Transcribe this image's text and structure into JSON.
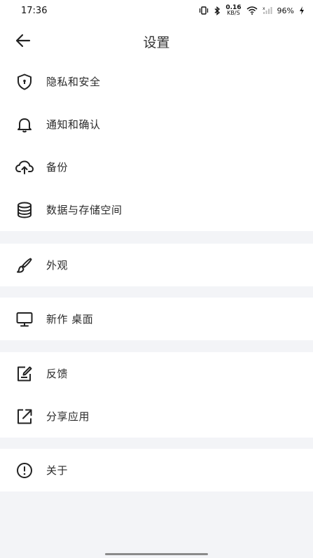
{
  "status_bar": {
    "time": "17:36",
    "net_speed_value": "0.16",
    "net_speed_unit": "KB/S",
    "battery": "96%"
  },
  "header": {
    "title": "设置"
  },
  "groups": [
    [
      {
        "label": "隐私和安全",
        "icon": "shield-icon"
      },
      {
        "label": "通知和确认",
        "icon": "bell-icon"
      },
      {
        "label": "备份",
        "icon": "cloud-upload-icon"
      },
      {
        "label": "数据与存储空间",
        "icon": "database-icon"
      }
    ],
    [
      {
        "label": "外观",
        "icon": "brush-icon"
      }
    ],
    [
      {
        "label": "新作 桌面",
        "icon": "monitor-icon"
      }
    ],
    [
      {
        "label": "反馈",
        "icon": "edit-icon"
      },
      {
        "label": "分享应用",
        "icon": "share-icon"
      }
    ],
    [
      {
        "label": "关于",
        "icon": "info-icon"
      }
    ]
  ]
}
